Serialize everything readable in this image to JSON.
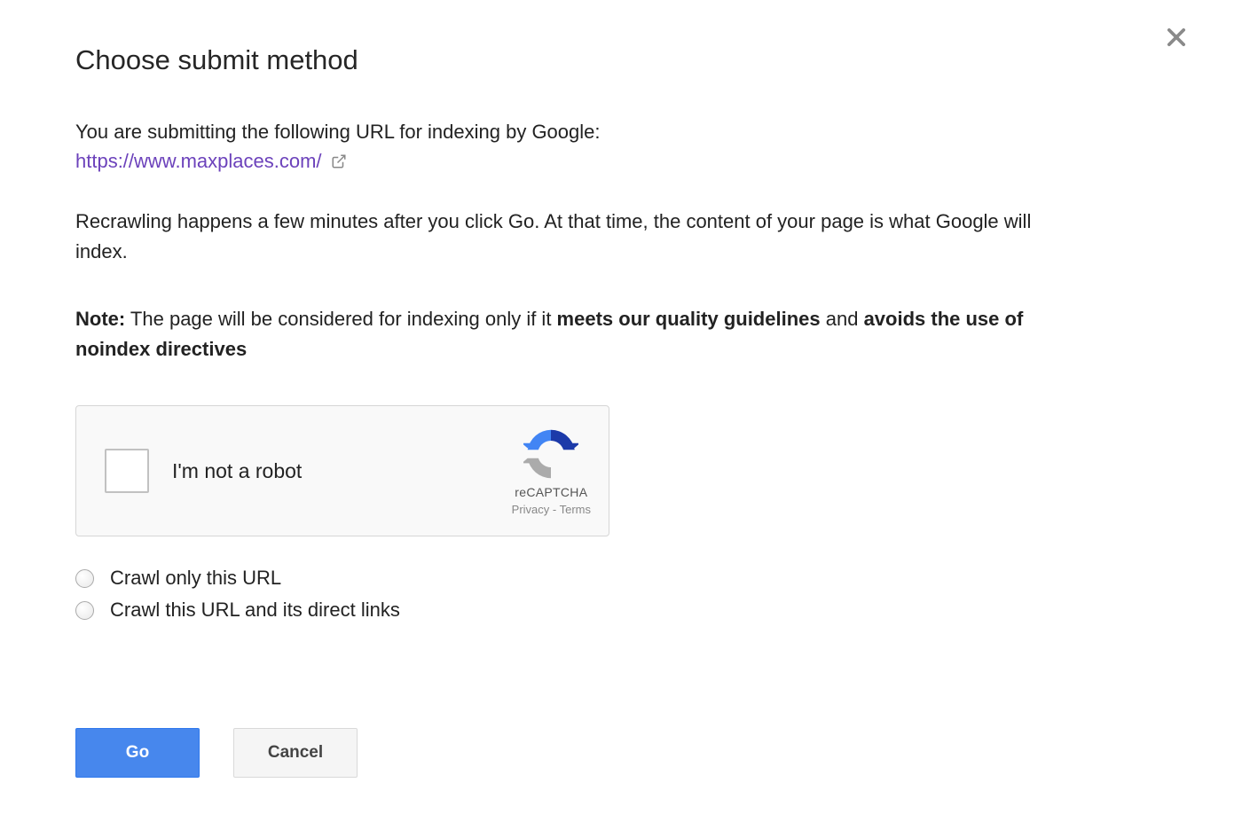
{
  "dialog": {
    "title": "Choose submit method",
    "intro": "You are submitting the following URL for indexing by Google:",
    "url": "https://www.maxplaces.com/",
    "recrawl": "Recrawling happens a few minutes after you click Go. At that time, the content of your page is what Google will index.",
    "note_prefix": "Note:",
    "note_mid1": " The page will be considered for indexing only if it ",
    "note_bold1": "meets our quality guidelines",
    "note_mid2": " and ",
    "note_bold2": "avoids the use of noindex directives"
  },
  "recaptcha": {
    "label": "I'm not a robot",
    "brand": "reCAPTCHA",
    "privacy": "Privacy",
    "separator": " - ",
    "terms": "Terms"
  },
  "options": {
    "crawl_only": "Crawl only this URL",
    "crawl_direct": "Crawl this URL and its direct links"
  },
  "buttons": {
    "go": "Go",
    "cancel": "Cancel"
  }
}
